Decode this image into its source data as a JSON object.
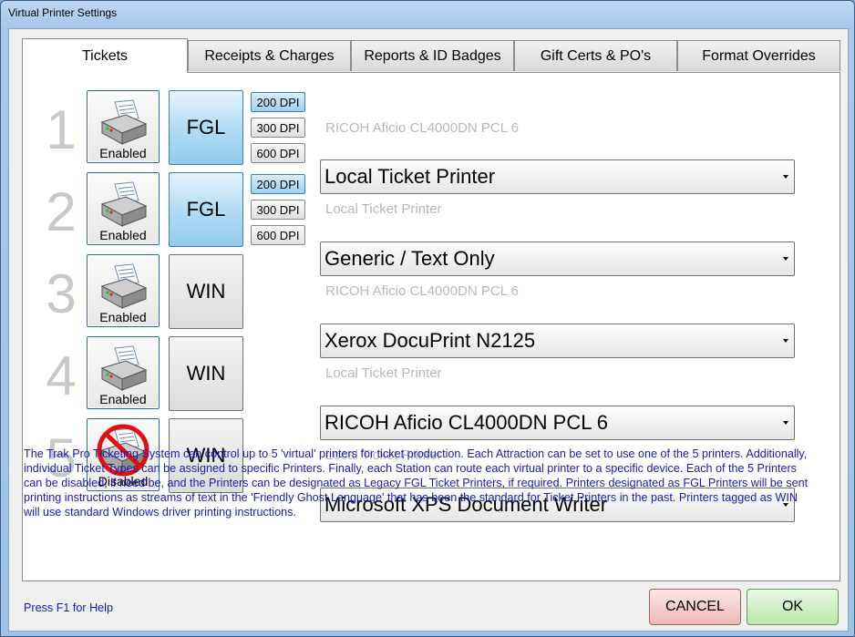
{
  "window": {
    "title": "Virtual Printer Settings"
  },
  "tabs": [
    {
      "label": "Tickets",
      "active": true
    },
    {
      "label": "Receipts & Charges"
    },
    {
      "label": "Reports & ID Badges"
    },
    {
      "label": "Gift Certs & PO's"
    },
    {
      "label": "Format Overrides"
    }
  ],
  "printers": [
    {
      "number": "1",
      "status": "Enabled",
      "type": "FGL",
      "dpi": [
        "200 DPI",
        "300 DPI",
        "600 DPI"
      ],
      "dpi_selected": "200 DPI",
      "hint": "RICOH Aficio CL4000DN PCL 6",
      "device": "Local Ticket Printer"
    },
    {
      "number": "2",
      "status": "Enabled",
      "type": "FGL",
      "dpi": [
        "200 DPI",
        "300 DPI",
        "600 DPI"
      ],
      "dpi_selected": "200 DPI",
      "hint": "Local Ticket Printer",
      "device": "Generic / Text Only"
    },
    {
      "number": "3",
      "status": "Enabled",
      "type": "WIN",
      "hint": "RICOH Aficio CL4000DN PCL 6",
      "device": "Xerox DocuPrint N2125"
    },
    {
      "number": "4",
      "status": "Enabled",
      "type": "WIN",
      "hint": "Local Ticket Printer",
      "device": "RICOH Aficio CL4000DN PCL 6"
    },
    {
      "number": "5",
      "status": "Disabled",
      "type": "WIN",
      "hint": "Local Ticket Printer",
      "device": "Microsoft XPS Document Writer"
    }
  ],
  "description": "The Trak Pro Ticketing System can control up to 5 'virtual' printers for ticket production.  Each Attraction can be set to use one of the 5 printers.  Additionally, individual Ticket Types can be assigned to specific Printers.  Finally, each Station can route each virtual printer to a specific device.  Each of the 5 Printers can be disabled, if need be, and the Printers can be designated as Legacy FGL Ticket Printers, if required.  Printers designated as FGL Printers will be sent printing instructions as streams of text in the 'Friendly Ghost Language' that has been the standard for Ticket Printers in the past.  Printers tagged as WIN will use standard Windows driver printing instructions.",
  "footer": {
    "help": "Press F1 for Help",
    "cancel_label": "CANCEL",
    "ok_label": "OK"
  },
  "colors": {
    "help_text": "#1a1ab0",
    "fgl_button": "#b2dcf5",
    "cancel": "#eeb7b7",
    "ok": "#b9e8ab"
  }
}
